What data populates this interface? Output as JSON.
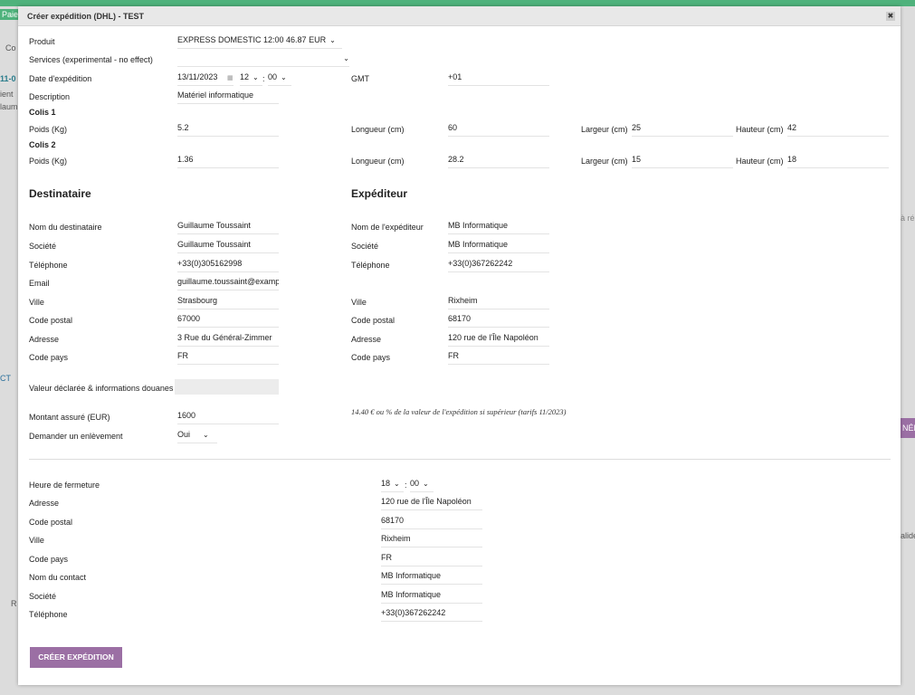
{
  "background": {
    "tab": "Paiem",
    "frag1": "Co",
    "frag2": "11-0",
    "frag3": "ient",
    "frag4": "laum",
    "frag5": "CT",
    "frag6": "R",
    "frag7": "à ré",
    "frag8": "NÉE",
    "frag9": "alide"
  },
  "modal": {
    "title": "Créer expédition (DHL) - TEST",
    "close": "✖"
  },
  "form": {
    "produit_label": "Produit",
    "produit_value": "EXPRESS DOMESTIC 12:00 46.87 EUR",
    "services_label": "Services (experimental - no effect)",
    "services_value": "",
    "date_label": "Date d'expédition",
    "date_value": "13/11/2023",
    "hour": "12",
    "minute": "00",
    "gmt_label": "GMT",
    "gmt_value": "+01",
    "description_label": "Description",
    "description_value": "Matériel informatique",
    "colis": [
      {
        "title": "Colis 1",
        "poids_label": "Poids (Kg)",
        "poids": "5.2",
        "longueur_label": "Longueur (cm)",
        "longueur": "60",
        "largeur_label": "Largeur (cm)",
        "largeur": "25",
        "hauteur_label": "Hauteur (cm)",
        "hauteur": "42"
      },
      {
        "title": "Colis 2",
        "poids_label": "Poids (Kg)",
        "poids": "1.36",
        "longueur_label": "Longueur (cm)",
        "longueur": "28.2",
        "largeur_label": "Largeur (cm)",
        "largeur": "15",
        "hauteur_label": "Hauteur (cm)",
        "hauteur": "18"
      }
    ],
    "destinataire": {
      "title": "Destinataire",
      "nom_label": "Nom du destinataire",
      "nom": "Guillaume Toussaint",
      "societe_label": "Société",
      "societe": "Guillaume Toussaint",
      "tel_label": "Téléphone",
      "tel": "+33(0)305162998",
      "email_label": "Email",
      "email": "guillaume.toussaint@example.com",
      "ville_label": "Ville",
      "ville": "Strasbourg",
      "cp_label": "Code postal",
      "cp": "67000",
      "adresse_label": "Adresse",
      "adresse": "3 Rue du Général-Zimmer",
      "pays_label": "Code pays",
      "pays": "FR"
    },
    "expediteur": {
      "title": "Expéditeur",
      "nom_label": "Nom de l'expéditeur",
      "nom": "MB Informatique",
      "societe_label": "Société",
      "societe": "MB Informatique",
      "tel_label": "Téléphone",
      "tel": "+33(0)367262242",
      "ville_label": "Ville",
      "ville": "Rixheim",
      "cp_label": "Code postal",
      "cp": "68170",
      "adresse_label": "Adresse",
      "adresse": "120 rue de l'Île Napoléon",
      "pays_label": "Code pays",
      "pays": "FR"
    },
    "valeur_label": "Valeur déclarée & informations douanes",
    "note": "14.40 € ou % de la valeur de l'expédition si supérieur (tarifs 11/2023)",
    "montant_label": "Montant assuré (EUR)",
    "montant": "1600",
    "enlevement_label": "Demander un enlèvement",
    "enlevement": "Oui",
    "pickup": {
      "heure_label": "Heure de fermeture",
      "hour": "18",
      "minute": "00",
      "adresse_label": "Adresse",
      "adresse": "120 rue de l'Île Napoléon",
      "cp_label": "Code postal",
      "cp": "68170",
      "ville_label": "Ville",
      "ville": "Rixheim",
      "pays_label": "Code pays",
      "pays": "FR",
      "contact_label": "Nom du contact",
      "contact": "MB Informatique",
      "societe_label": "Société",
      "societe": "MB Informatique",
      "tel_label": "Téléphone",
      "tel": "+33(0)367262242"
    },
    "submit": "CRÉER EXPÉDITION"
  }
}
